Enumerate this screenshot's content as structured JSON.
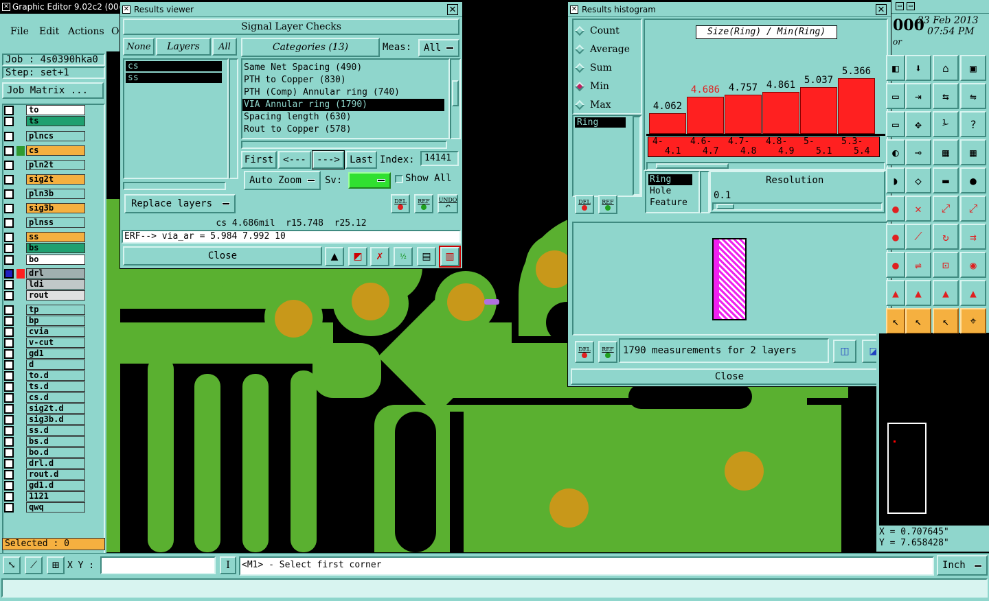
{
  "app": {
    "title": "Graphic Editor 9.02c2 (00@",
    "menu": [
      "File",
      "Edit",
      "Actions",
      "O"
    ],
    "job_label": "Job : 4s0390hka0",
    "step_label": "Step: set+1",
    "job_matrix_btn": "Job Matrix ...",
    "selected_label": "Selected : 0",
    "date": "23 Feb 2013",
    "time": "07:54 PM",
    "coord_x": "X = 0.707645\"",
    "coord_y": "Y = 7.658428\"",
    "xy_label": "X Y :",
    "status_msg": "<M1> - Select first corner",
    "unit": "Inch",
    "clock_fragment": "000",
    "corner_fragment": "or"
  },
  "layers": [
    {
      "name": "to",
      "color": "#ffffff"
    },
    {
      "name": "ts",
      "color": "#1fa070"
    },
    {
      "name": "plncs",
      "color": "#8fd6cc"
    },
    {
      "name": "cs",
      "color": "#f5b040",
      "active": true
    },
    {
      "name": "pln2t",
      "color": "#8fd6cc"
    },
    {
      "name": "sig2t",
      "color": "#f5b040"
    },
    {
      "name": "pln3b",
      "color": "#8fd6cc"
    },
    {
      "name": "sig3b",
      "color": "#f5b040"
    },
    {
      "name": "plnss",
      "color": "#8fd6cc"
    },
    {
      "name": "ss",
      "color": "#f5b040"
    },
    {
      "name": "bs",
      "color": "#1fa070"
    },
    {
      "name": "bo",
      "color": "#ffffff"
    },
    {
      "name": "drl",
      "color": "#a0b0b0",
      "red": true
    },
    {
      "name": "ldi",
      "color": "#c0c8c8"
    },
    {
      "name": "rout",
      "color": "#e0e0e0"
    },
    {
      "name": "tp",
      "color": "#8fd6cc"
    },
    {
      "name": "bp",
      "color": "#8fd6cc"
    },
    {
      "name": "cvia",
      "color": "#8fd6cc"
    },
    {
      "name": "v-cut",
      "color": "#8fd6cc"
    },
    {
      "name": "gd1",
      "color": "#8fd6cc"
    },
    {
      "name": "d",
      "color": "#8fd6cc"
    },
    {
      "name": "to.d",
      "color": "#8fd6cc"
    },
    {
      "name": "ts.d",
      "color": "#8fd6cc"
    },
    {
      "name": "cs.d",
      "color": "#8fd6cc"
    },
    {
      "name": "sig2t.d",
      "color": "#8fd6cc"
    },
    {
      "name": "sig3b.d",
      "color": "#8fd6cc"
    },
    {
      "name": "ss.d",
      "color": "#8fd6cc"
    },
    {
      "name": "bs.d",
      "color": "#8fd6cc"
    },
    {
      "name": "bo.d",
      "color": "#8fd6cc"
    },
    {
      "name": "drl.d",
      "color": "#8fd6cc"
    },
    {
      "name": "rout.d",
      "color": "#8fd6cc"
    },
    {
      "name": "gd1.d",
      "color": "#8fd6cc"
    },
    {
      "name": "1121",
      "color": "#8fd6cc"
    },
    {
      "name": "qwq",
      "color": "#8fd6cc"
    }
  ],
  "results_viewer": {
    "title": "Results viewer",
    "header": "Signal Layer Checks",
    "none_btn": "None",
    "layers_btn": "Layers",
    "all_btn": "All",
    "categories_btn": "Categories (13)",
    "meas_label": "Meas:",
    "meas_value": "All",
    "layer_list": [
      "cs",
      "ss"
    ],
    "categories": [
      "Same Net Spacing (490)",
      "PTH to Copper (830)",
      "PTH (Comp) Annular ring (740)",
      "VIA Annular ring (1790)",
      "Spacing length (630)",
      "Rout to Copper (578)"
    ],
    "selected_category": 3,
    "first_btn": "First",
    "prev_btn": "<---",
    "next_btn": "--->",
    "last_btn": "Last",
    "index_label": "Index:",
    "index_value": "14141",
    "auto_zoom": "Auto Zoom",
    "sv_label": "Sv:",
    "show_all": "Show All",
    "replace_layers": "Replace layers",
    "del": "DEL",
    "ref": "REF",
    "undo": "UNDO",
    "info_line": "cs 4.686mil  r15.748  r25.12",
    "erf_line": "ERF--> via_ar = 5.984 7.992 10",
    "close": "Close"
  },
  "histogram": {
    "title": "Results histogram",
    "options": [
      "Count",
      "Average",
      "Sum",
      "Min",
      "Max"
    ],
    "selected_option": "Min",
    "chart_title": "Size(Ring) / Min(Ring)",
    "ring_list": [
      "Ring"
    ],
    "size_list": [
      "Ring",
      "Hole",
      "Feature"
    ],
    "resolution_label": "Resolution",
    "resolution_value": "0.1",
    "status": "1790 measurements for 2 layers",
    "close": "Close",
    "del": "DEL",
    "ref": "REF"
  },
  "chart_data": {
    "type": "bar",
    "title": "Size(Ring) / Min(Ring)",
    "categories": [
      "4-4.1",
      "4.6-4.7",
      "4.7-4.8",
      "4.8-4.9",
      "5-5.1",
      "5.3-5.4"
    ],
    "category_labels_top": [
      "4-",
      "4.6-",
      "4.7-",
      "4.8-",
      "5-",
      "5.3-"
    ],
    "category_labels_bottom": [
      "4.1",
      "4.7",
      "4.8",
      "4.9",
      "5.1",
      "5.4"
    ],
    "values": [
      4.062,
      4.686,
      4.757,
      4.861,
      5.037,
      5.366
    ],
    "highlight_index": 1,
    "ylim": [
      3.3,
      5.5
    ],
    "bar_color": "#ff2020"
  }
}
